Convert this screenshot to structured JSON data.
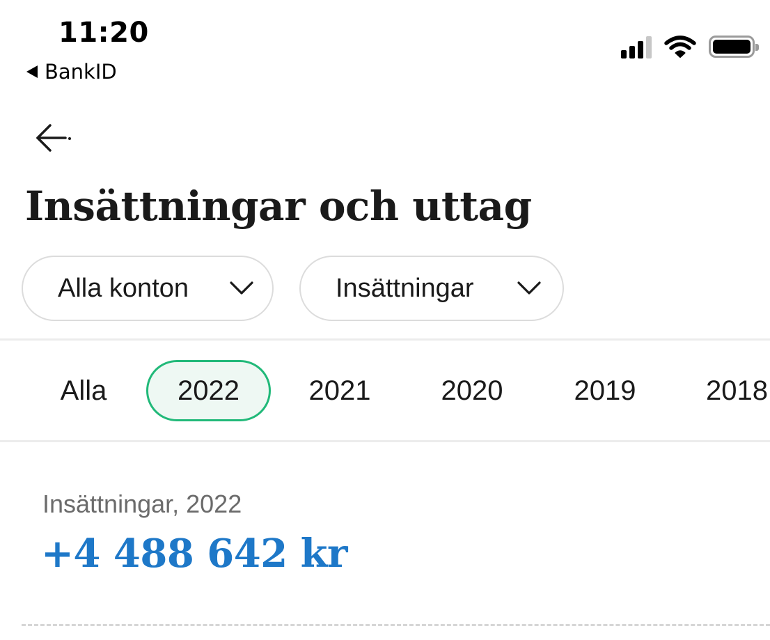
{
  "status_bar": {
    "time": "11:20",
    "back_app_label": "BankID",
    "icons": [
      "cellular-signal-icon",
      "wifi-icon",
      "battery-icon"
    ]
  },
  "nav": {
    "back_icon": "arrow-left-icon"
  },
  "header": {
    "title": "Insättningar och uttag"
  },
  "filters": {
    "accounts": {
      "selected": "Alla konton",
      "icon": "chevron-down-icon"
    },
    "type": {
      "selected": "Insättningar",
      "icon": "chevron-down-icon"
    }
  },
  "year_tabs": {
    "items": [
      {
        "label": "Alla",
        "active": false
      },
      {
        "label": "2022",
        "active": true
      },
      {
        "label": "2021",
        "active": false
      },
      {
        "label": "2020",
        "active": false
      },
      {
        "label": "2019",
        "active": false
      },
      {
        "label": "2018",
        "active": false
      }
    ]
  },
  "summary": {
    "label": "Insättningar, 2022",
    "amount": "+4 488 642 kr"
  },
  "colors": {
    "accent_green": "#21b979",
    "active_tab_bg": "#eef8f3",
    "amount_blue": "#1e78c8"
  }
}
